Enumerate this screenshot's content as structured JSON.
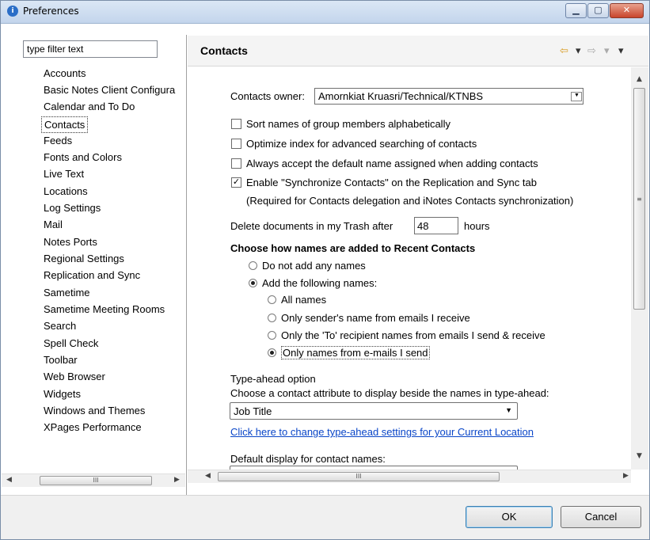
{
  "window": {
    "title": "Preferences",
    "app_icon": "lotus-notes-icon",
    "controls": {
      "minimize": "▁",
      "maximize": "▢",
      "close": "✕"
    }
  },
  "sidebar": {
    "filter_value": "type filter text",
    "items": [
      {
        "label": "Accounts"
      },
      {
        "label": "Basic Notes Client Configura"
      },
      {
        "label": "Calendar and To Do"
      },
      {
        "label": "Contacts",
        "selected": true
      },
      {
        "label": "Feeds"
      },
      {
        "label": "Fonts and Colors"
      },
      {
        "label": "Live Text"
      },
      {
        "label": "Locations"
      },
      {
        "label": "Log Settings"
      },
      {
        "label": "Mail"
      },
      {
        "label": "Notes Ports"
      },
      {
        "label": "Regional Settings"
      },
      {
        "label": "Replication and Sync"
      },
      {
        "label": "Sametime"
      },
      {
        "label": "Sametime Meeting Rooms"
      },
      {
        "label": "Search"
      },
      {
        "label": "Spell Check"
      },
      {
        "label": "Toolbar"
      },
      {
        "label": "Web Browser"
      },
      {
        "label": "Widgets"
      },
      {
        "label": "Windows and Themes"
      },
      {
        "label": "XPages Performance"
      }
    ],
    "scroll_thumb_glyph": "III"
  },
  "header": {
    "title": "Contacts",
    "back_icon": "⇦",
    "forward_icon": "⇨",
    "dropdown_icon": "▾"
  },
  "contacts": {
    "owner_label": "Contacts owner:",
    "owner_value": "Amornkiat Kruasri/Technical/KTNBS",
    "checkboxes": [
      {
        "label": "Sort names of group members alphabetically",
        "checked": false
      },
      {
        "label": "Optimize index for advanced searching of contacts",
        "checked": false
      },
      {
        "label": "Always accept the default name assigned when adding contacts",
        "checked": false
      },
      {
        "label": "Enable \"Synchronize Contacts\" on the Replication and Sync tab",
        "checked": true
      }
    ],
    "sync_note": "(Required for Contacts delegation and iNotes Contacts synchronization)",
    "trash_label": "Delete documents in my Trash after",
    "trash_value": "48",
    "trash_unit": "hours",
    "recent_heading": "Choose how names are added to Recent Contacts",
    "recent_options": [
      {
        "label": "Do not add any names",
        "checked": false
      },
      {
        "label": "Add the following names:",
        "checked": true
      }
    ],
    "sub_options": [
      {
        "label": "All names",
        "checked": false
      },
      {
        "label": "Only sender's name from emails I receive",
        "checked": false
      },
      {
        "label": "Only the 'To' recipient names from emails I send & receive",
        "checked": false
      },
      {
        "label": "Only names from e-mails I send",
        "checked": true
      }
    ],
    "typeahead_heading": "Type-ahead option",
    "typeahead_desc": "Choose a contact attribute to display beside the names in type-ahead:",
    "typeahead_value": "Job Title",
    "typeahead_link": "Click here to change type-ahead settings for your Current Location",
    "default_display_label": "Default display for contact names:"
  },
  "content_scroll": {
    "glyph_h": "III",
    "glyph_v": "≡"
  },
  "buttons": {
    "ok": "OK",
    "cancel": "Cancel"
  }
}
